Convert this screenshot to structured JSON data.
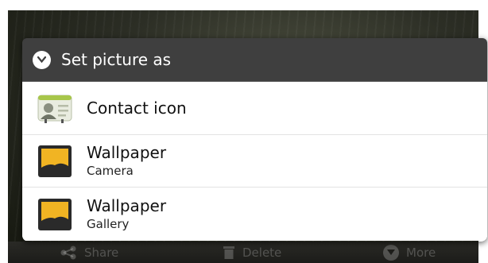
{
  "dialog": {
    "title": "Set picture as",
    "items": [
      {
        "label": "Contact icon",
        "icon": "contact-card-icon"
      },
      {
        "label": "Wallpaper",
        "sublabel": "Camera",
        "icon": "wallpaper-image-icon"
      },
      {
        "label": "Wallpaper",
        "sublabel": "Gallery",
        "icon": "wallpaper-image-icon"
      }
    ]
  },
  "background_menu": {
    "ghost_label": "",
    "share_label": "Share",
    "delete_label": "Delete",
    "more_label": "More"
  },
  "colors": {
    "titlebar": "#3f3f3f",
    "list_background": "#ffffff",
    "wallpaper_sun": "#f1b423"
  }
}
